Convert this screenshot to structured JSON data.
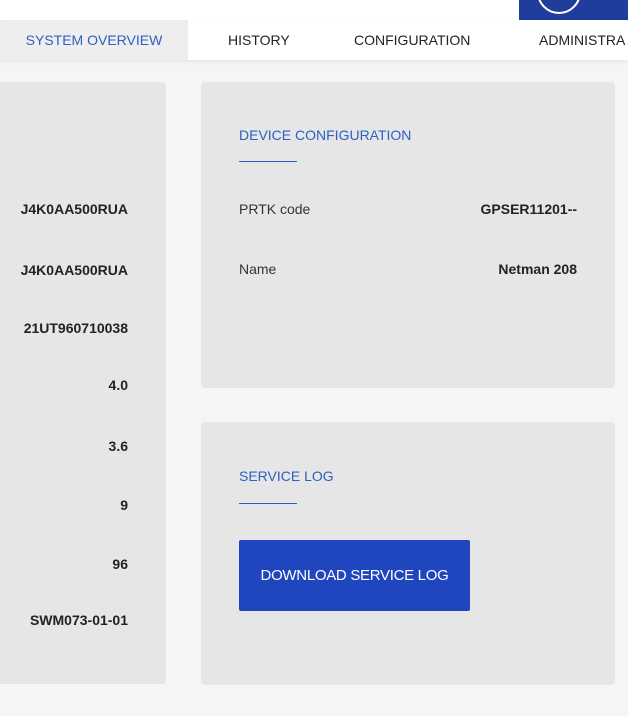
{
  "nav": {
    "tabs": [
      {
        "label": "SYSTEM OVERVIEW",
        "active": true
      },
      {
        "label": "HISTORY",
        "active": false
      },
      {
        "label": "CONFIGURATION",
        "active": false
      },
      {
        "label": "ADMINISTRA",
        "active": false
      }
    ]
  },
  "left_panel": {
    "values": [
      "J4K0AA500RUA",
      "J4K0AA500RUA",
      "21UT960710038",
      "4.0",
      "3.6",
      "9",
      "96",
      "SWM073-01-01"
    ]
  },
  "device_configuration": {
    "title": "DEVICE CONFIGURATION",
    "fields": [
      {
        "label": "PRTK code",
        "value": "GPSER11201--"
      },
      {
        "label": "Name",
        "value": "Netman 208"
      }
    ]
  },
  "service_log": {
    "title": "SERVICE LOG",
    "download_button": "DOWNLOAD SERVICE LOG"
  },
  "colors": {
    "accent": "#2d5fc4",
    "button": "#1f45bf",
    "panel": "#e6e6e6",
    "background": "#f5f5f5"
  }
}
